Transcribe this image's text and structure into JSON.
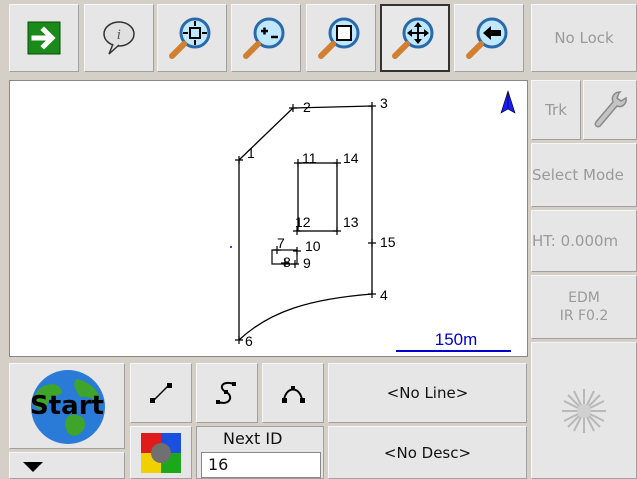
{
  "toolbar": {
    "icons": [
      "next-arrow-icon",
      "info-balloon-icon",
      "zoom-extents-icon",
      "zoom-out-icon",
      "zoom-window-icon",
      "pan-icon",
      "zoom-previous-icon"
    ]
  },
  "side": {
    "lock_label": "No Lock",
    "trk_label": "Trk",
    "select_mode_label": "Select Mode",
    "ht_label": "HT: 0.000m",
    "edm_line1": "EDM",
    "edm_line2": "IR F0.2"
  },
  "map": {
    "points": [
      {
        "label": "1"
      },
      {
        "label": "2"
      },
      {
        "label": "3"
      },
      {
        "label": "4"
      },
      {
        "label": "6"
      },
      {
        "label": "7"
      },
      {
        "label": "8"
      },
      {
        "label": "9"
      },
      {
        "label": "10"
      },
      {
        "label": "11"
      },
      {
        "label": "12"
      },
      {
        "label": "13"
      },
      {
        "label": "14"
      },
      {
        "label": "15"
      }
    ],
    "scale_label": "150m",
    "colors": {
      "north": "#1a1aff",
      "scale": "#0000cc"
    }
  },
  "bottom": {
    "start_label": "Start",
    "no_line_label": "<No Line>",
    "no_desc_label": "<No Desc>",
    "next_id_label": "Next ID",
    "next_id_value": "16"
  }
}
